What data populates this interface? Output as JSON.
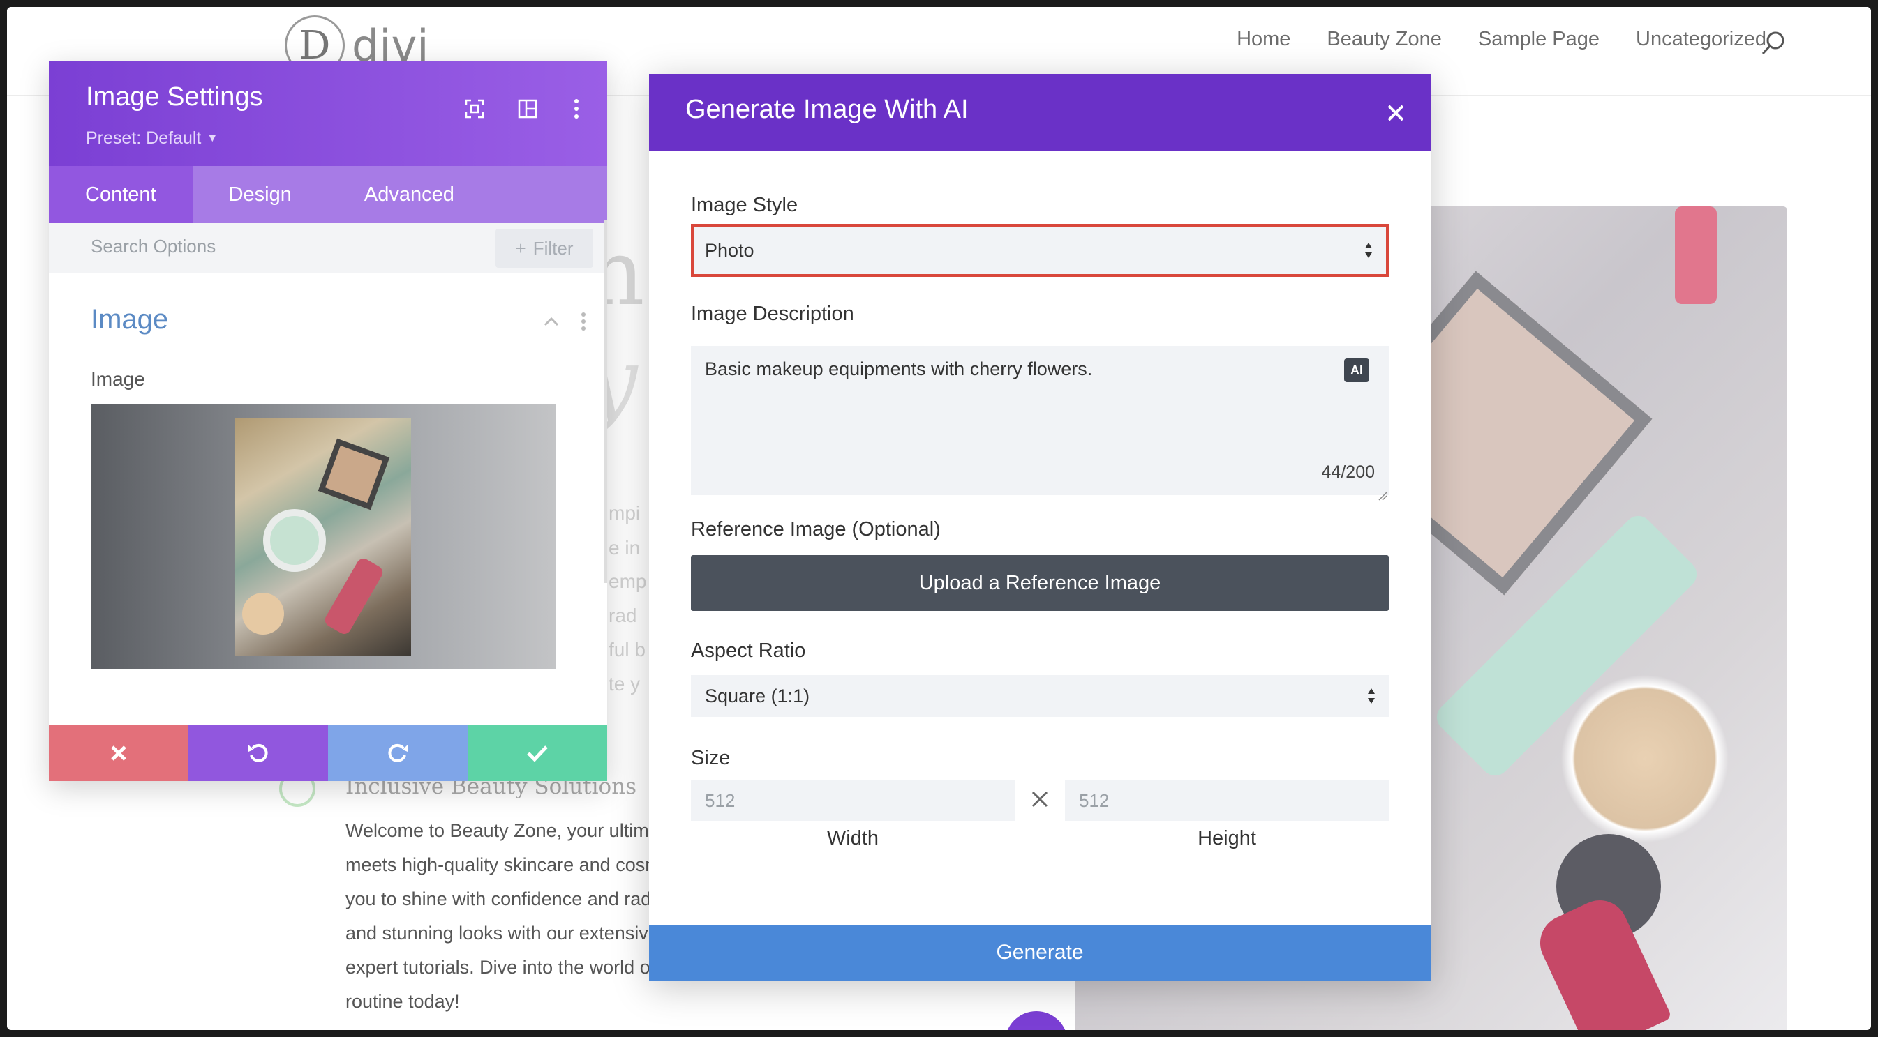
{
  "site": {
    "logo_letter": "D",
    "logo_text": "divi",
    "nav": [
      "Home",
      "Beauty Zone",
      "Sample Page",
      "Uncategorized"
    ]
  },
  "background": {
    "heading_fragment": "n",
    "heading_fragment_2": "y",
    "text_fragments": [
      "mpi",
      "e in",
      "emp",
      "rad",
      "ful b",
      "te y"
    ],
    "feature_title": "Inclusive Beauty Solutions",
    "paragraph_lines": [
      "Welcome to Beauty Zone, your ultima",
      "meets high-quality skincare and cosm",
      "you to shine with confidence and rad",
      "and stunning looks with our extensiv",
      "expert tutorials. Dive into the world o",
      "routine today!"
    ]
  },
  "settings_panel": {
    "title": "Image Settings",
    "preset": "Preset: Default",
    "tabs": [
      {
        "label": "Content",
        "active": true
      },
      {
        "label": "Design",
        "active": false
      },
      {
        "label": "Advanced",
        "active": false
      }
    ],
    "search_placeholder": "Search Options",
    "filter_label": "Filter",
    "section_title": "Image",
    "image_label": "Image"
  },
  "ai_modal": {
    "title": "Generate Image With AI",
    "image_style_label": "Image Style",
    "image_style_value": "Photo",
    "description_label": "Image Description",
    "description_value": "Basic makeup equipments with cherry flowers.",
    "ai_badge": "AI",
    "char_count": "44/200",
    "reference_label": "Reference Image (Optional)",
    "upload_button": "Upload a Reference Image",
    "aspect_label": "Aspect Ratio",
    "aspect_value": "Square (1:1)",
    "size_label": "Size",
    "width_placeholder": "512",
    "height_placeholder": "512",
    "width_caption": "Width",
    "height_caption": "Height",
    "generate_button": "Generate"
  },
  "colors": {
    "modal_header": "#6a31c7",
    "settings_header": "#7b3fd4",
    "generate": "#4a88d8",
    "focus_border": "#d9473b"
  }
}
